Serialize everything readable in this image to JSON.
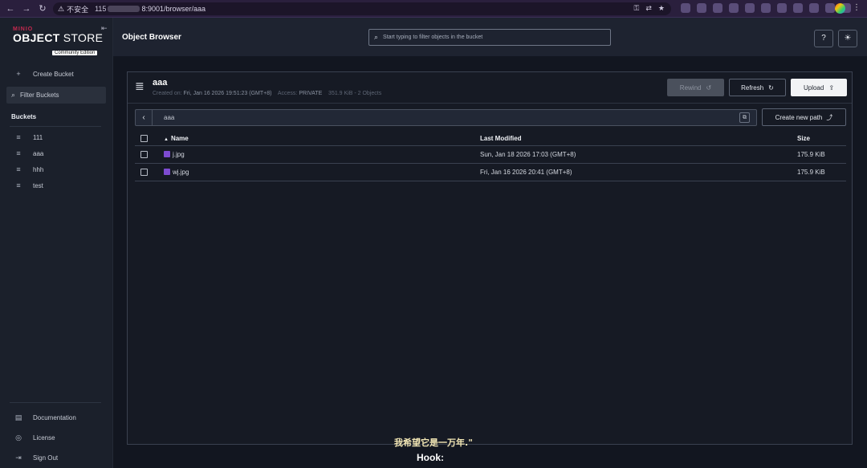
{
  "browser": {
    "security_label": "不安全",
    "url_prefix": "115",
    "url_suffix": "8:9001/browser/aaa"
  },
  "sidebar": {
    "logo_brand": "MINIO",
    "logo_object": "OBJECT",
    "logo_store": " STORE",
    "logo_edition": "Community Edition",
    "create_bucket": "Create Bucket",
    "filter_placeholder": "Filter Buckets",
    "buckets_title": "Buckets",
    "buckets": [
      "111",
      "aaa",
      "hhh",
      "test"
    ],
    "footer": [
      "Documentation",
      "License",
      "Sign Out"
    ]
  },
  "header": {
    "title": "Object Browser",
    "search_placeholder": "Start typing to filter objects in the bucket"
  },
  "bucket": {
    "name": "aaa",
    "created_label": "Created on:",
    "created_value": "Fri, Jan 16 2026 19:51:23 (GMT+8)",
    "access_label": "Access:",
    "access_value": "PRIVATE",
    "stats": "351.9 KiB - 2 Objects",
    "rewind_label": "Rewind",
    "refresh_label": "Refresh",
    "upload_label": "Upload",
    "path": "aaa",
    "create_path_label": "Create new path"
  },
  "table": {
    "columns": [
      "Name",
      "Last Modified",
      "Size"
    ],
    "rows": [
      {
        "name": "j.jpg",
        "modified": "Sun, Jan 18 2026 17:03 (GMT+8)",
        "size": "175.9 KiB"
      },
      {
        "name": "wj.jpg",
        "modified": "Fri, Jan 16 2026 20:41 (GMT+8)",
        "size": "175.9 KiB"
      }
    ]
  },
  "subtitles": {
    "line1": "我希望它是一万年.\"",
    "line2": "Hook:"
  },
  "colors": {
    "accent_minio": "#c7294f",
    "background": "#121620",
    "sidebar": "#1b202b"
  }
}
